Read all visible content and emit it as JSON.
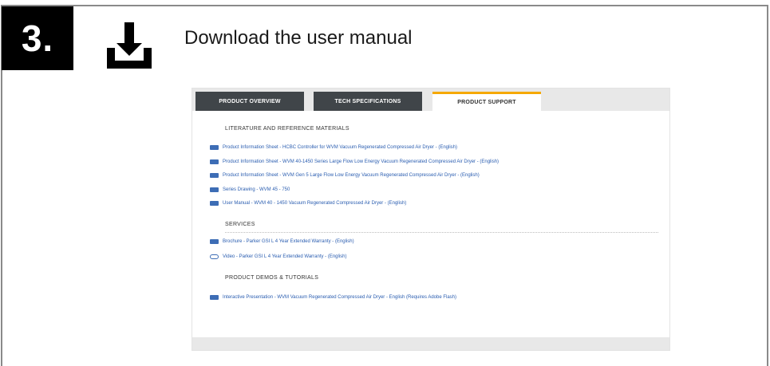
{
  "step": {
    "number": "3."
  },
  "header": {
    "title": "Download the user manual",
    "icon": "download-icon"
  },
  "tabs": [
    {
      "label": "PRODUCT OVERVIEW",
      "active": false
    },
    {
      "label": "TECH SPECIFICATIONS",
      "active": false
    },
    {
      "label": "PRODUCT SUPPORT",
      "active": true
    }
  ],
  "sections": [
    {
      "title": "LITERATURE AND REFERENCE MATERIALS",
      "items": [
        {
          "icon": "pdf-icon",
          "label": "Product Information Sheet - HCBC Controller for WVM Vacuum Regenerated Compressed Air Dryer - (English)"
        },
        {
          "icon": "pdf-icon",
          "label": "Product Information Sheet - WVM 40-1450 Series Large Flow Low Energy Vacuum Regenerated Compressed Air Dryer - (English)"
        },
        {
          "icon": "pdf-icon",
          "label": "Product Information Sheet - WVM Gen 5 Large Flow Low Energy Vacuum Regenerated Compressed Air Dryer - (English)"
        },
        {
          "icon": "pdf-icon",
          "label": "Series Drawing - WVM 45 - 750"
        },
        {
          "icon": "pdf-icon",
          "label": "User Manual - WVM 40 - 1450 Vacuum Regenerated Compressed Air Dryer - (English)"
        }
      ]
    },
    {
      "title": "SERVICES",
      "items": [
        {
          "icon": "pdf-icon",
          "label": "Brochure - Parker GSI L 4 Year Extended Warranty - (English)"
        },
        {
          "icon": "video-icon",
          "label": "Video - Parker GSI L 4 Year Extended Warranty - (English)"
        }
      ]
    },
    {
      "title": "PRODUCT DEMOS & TUTORIALS",
      "items": [
        {
          "icon": "presentation-icon",
          "label": "Interactive Presentation - WVM Vacuum Regenerated Compressed Air Dryer - English (Requires Adobe Flash)"
        }
      ]
    }
  ],
  "colors": {
    "accent": "#f5a800",
    "tab_dark": "#404549",
    "link": "#2a5db0"
  }
}
